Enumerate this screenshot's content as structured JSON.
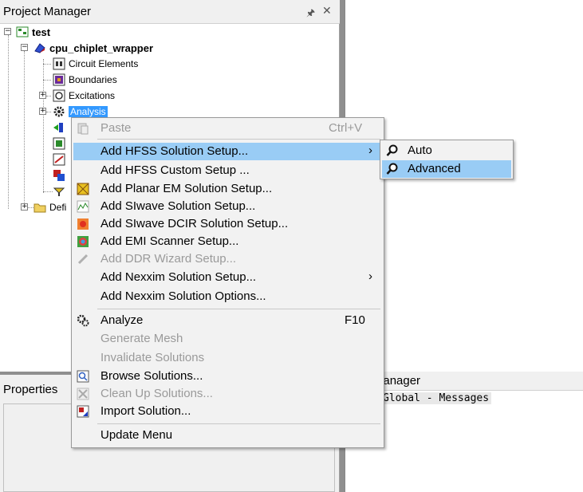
{
  "project_manager": {
    "title": "Project Manager",
    "pin_icon": "pin-icon",
    "close_icon": "close-icon"
  },
  "tree": {
    "root": "test",
    "design": "cpu_chiplet_wrapper",
    "items": [
      "Circuit Elements",
      "Boundaries",
      "Excitations",
      "Analysis"
    ],
    "definitions": "Defi"
  },
  "properties": {
    "title": "Properties"
  },
  "message_manager": {
    "title_partial": "ge Manager",
    "line": "Global - Messages"
  },
  "context_menu": {
    "paste": {
      "label": "Paste",
      "shortcut": "Ctrl+V"
    },
    "add_hfss_setup": "Add HFSS Solution Setup...",
    "add_hfss_custom": "Add HFSS Custom Setup ...",
    "add_planar_em": "Add Planar EM Solution Setup...",
    "add_siwave": "Add SIwave Solution Setup...",
    "add_siwave_dcir": "Add SIwave DCIR Solution Setup...",
    "add_emi": "Add EMI Scanner Setup...",
    "add_ddr": "Add DDR Wizard Setup...",
    "add_nexxim_setup": "Add Nexxim Solution Setup...",
    "add_nexxim_options": "Add Nexxim Solution Options...",
    "analyze": {
      "label": "Analyze",
      "shortcut": "F10"
    },
    "generate_mesh": "Generate Mesh",
    "invalidate": "Invalidate Solutions",
    "browse": "Browse Solutions...",
    "cleanup": "Clean Up Solutions...",
    "import": "Import Solution...",
    "update": "Update Menu"
  },
  "submenu": {
    "auto": "Auto",
    "advanced": "Advanced"
  },
  "colors": {
    "highlight": "#99ccf5",
    "selection": "#3399ff",
    "disabled_text": "#9a9a9a"
  }
}
